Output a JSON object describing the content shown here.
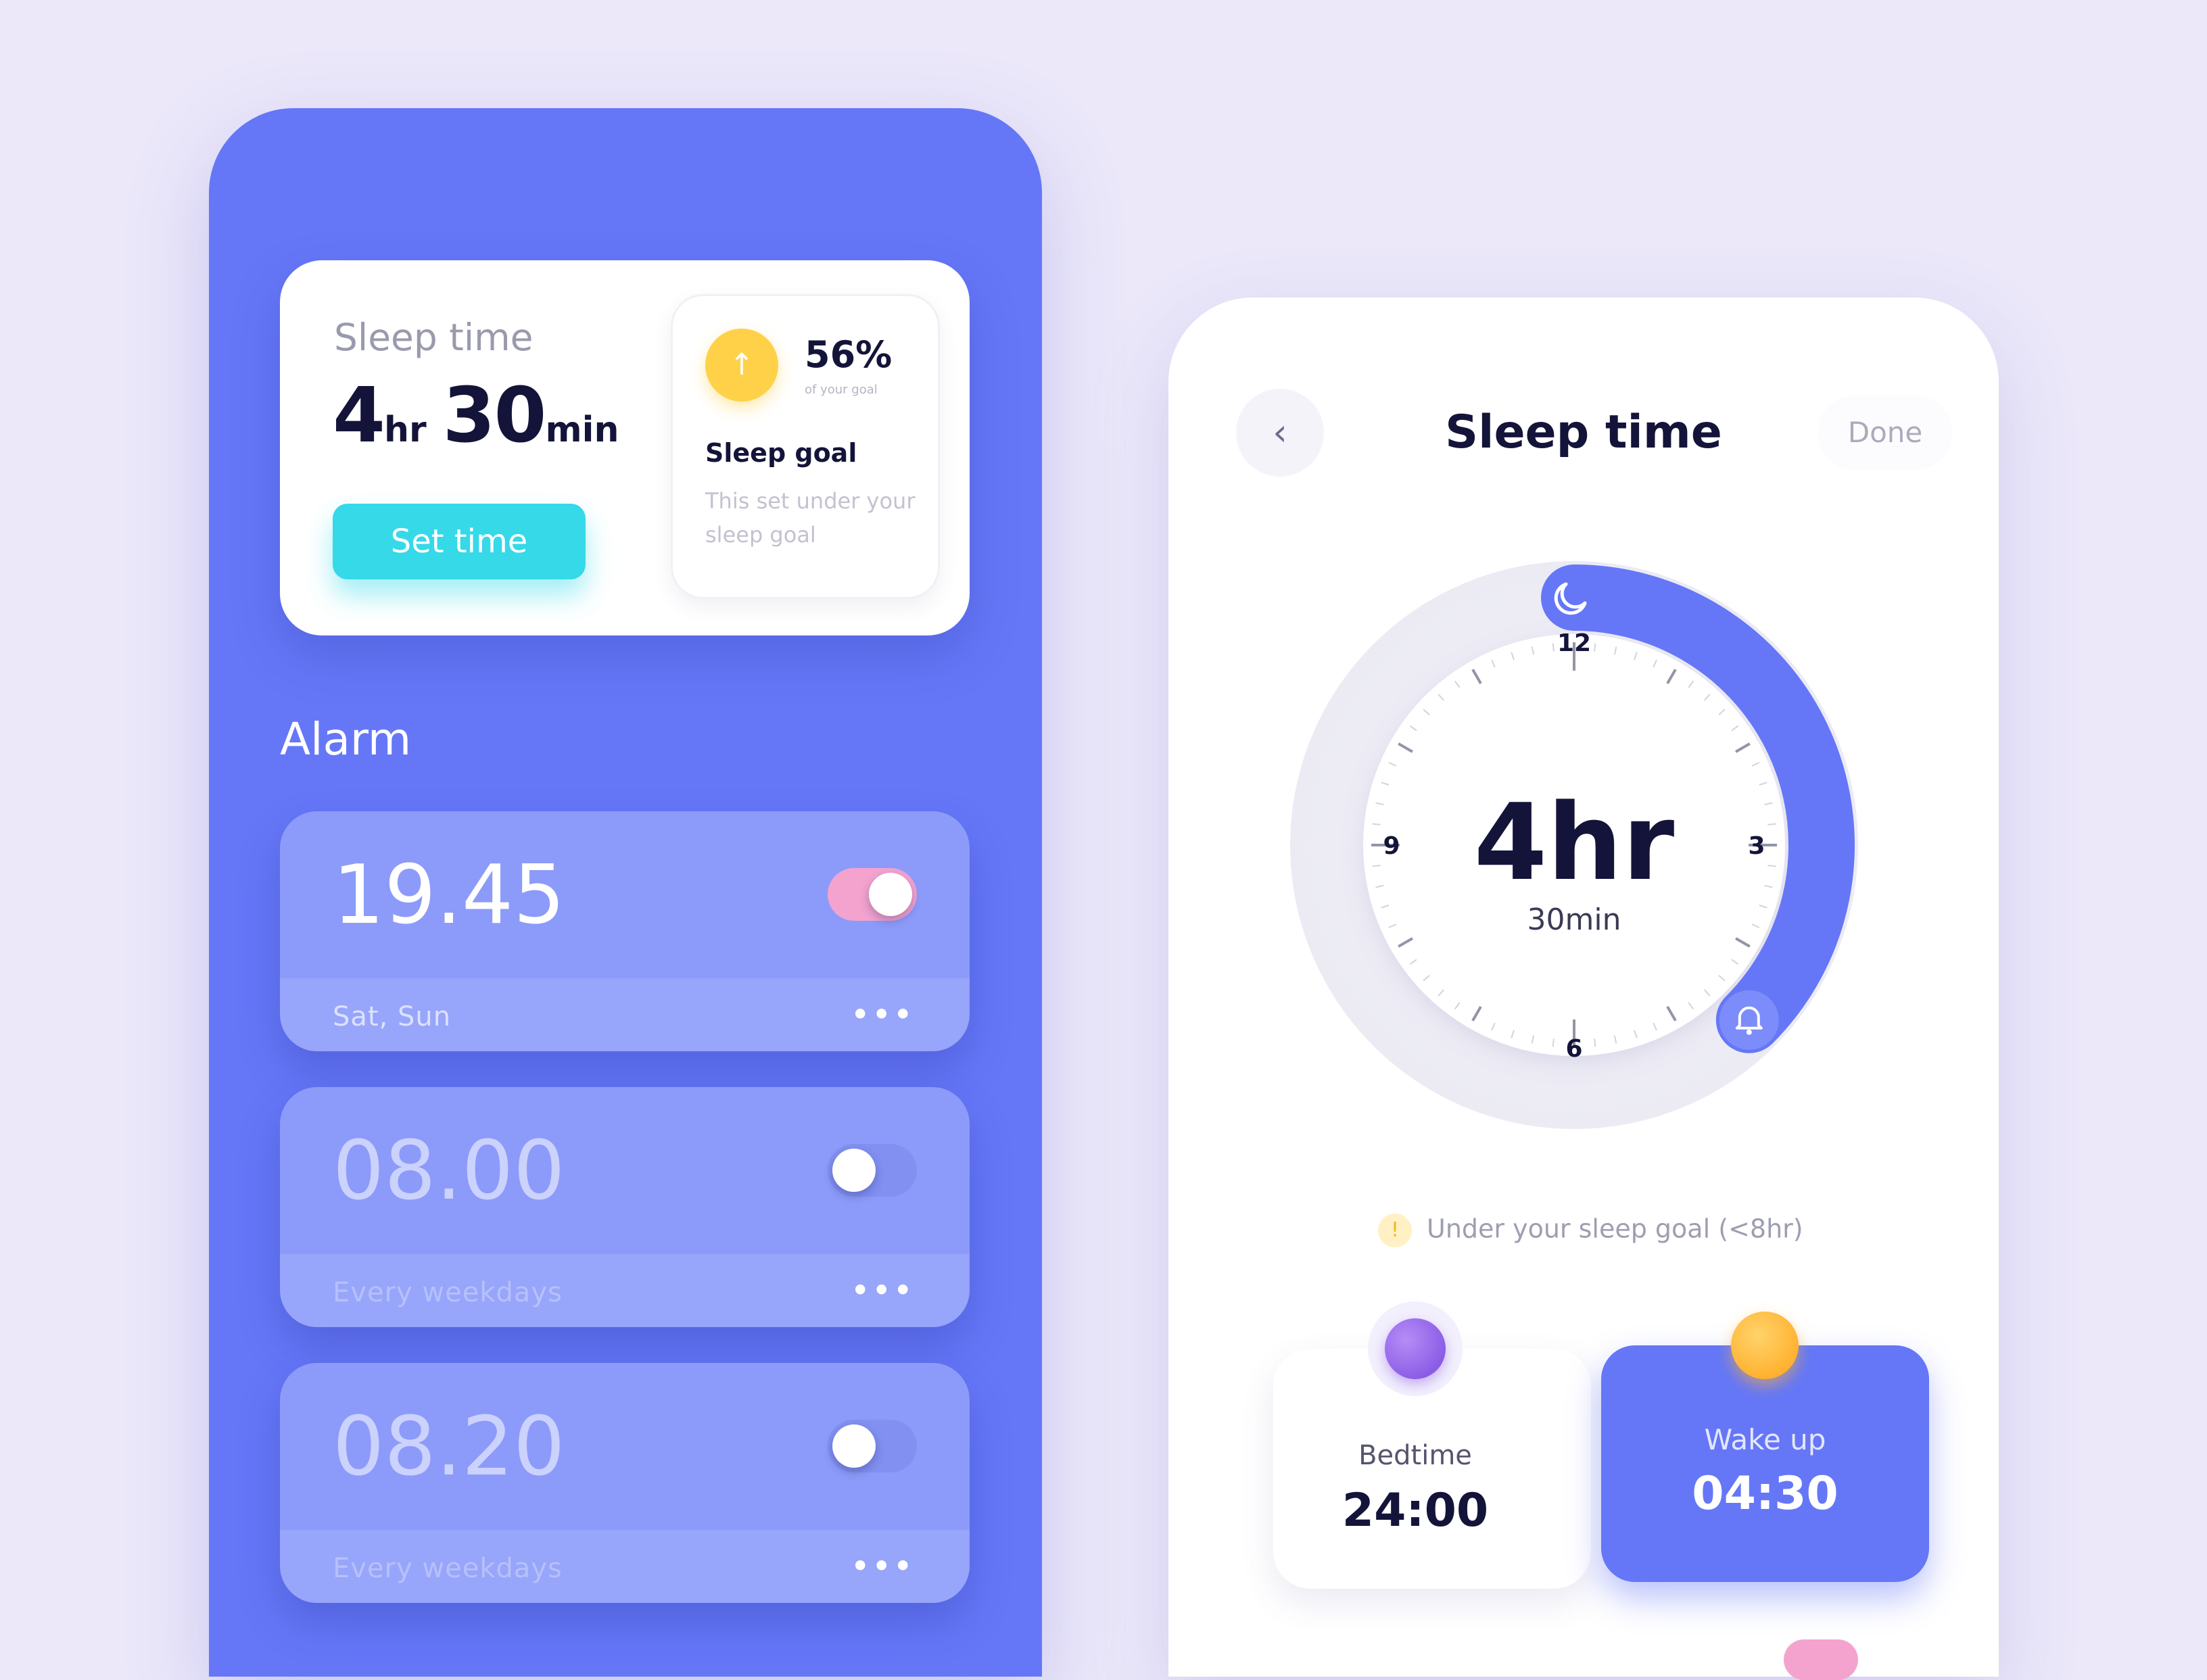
{
  "left_screen": {
    "sleep_card": {
      "title": "Sleep time",
      "hours": "4",
      "hours_unit": "hr",
      "minutes": "30",
      "minutes_unit": "min",
      "set_time_label": "Set time",
      "goal": {
        "icon": "arrow-up-icon",
        "percent": "56%",
        "percent_caption": "of your goal",
        "title": "Sleep goal",
        "description": "This set under your sleep goal"
      }
    },
    "alarm_heading": "Alarm",
    "alarms": [
      {
        "time": "19.45",
        "days": "Sat, Sun",
        "enabled": true,
        "more": "•••"
      },
      {
        "time": "08.00",
        "days": "Every weekdays",
        "enabled": false,
        "more": "•••"
      },
      {
        "time": "08.20",
        "days": "Every weekdays",
        "enabled": false,
        "more": "•••"
      }
    ]
  },
  "right_screen": {
    "back_icon": "chevron-left-icon",
    "back_glyph": "‹",
    "title": "Sleep time",
    "done_label": "Done",
    "dial": {
      "hours": "4hr",
      "minutes": "30min",
      "labels": {
        "top": "12",
        "right": "3",
        "bottom": "6",
        "left": "9"
      },
      "bedtime_icon": "moon-icon",
      "wake_icon": "bell-icon",
      "sleep_arc_start": "24:00",
      "sleep_arc_end": "04:30"
    },
    "goal_note": {
      "icon": "warning-icon",
      "glyph": "!",
      "text": "Under your sleep goal (<8hr)"
    },
    "bedtime": {
      "label": "Bedtime",
      "time": "24:00",
      "icon": "moon-planet-icon"
    },
    "wakeup": {
      "label": "Wake up",
      "time": "04:30",
      "icon": "sun-icon"
    }
  },
  "colors": {
    "background": "#ECE8FA",
    "primary": "#6577F7",
    "cyan_button": "#35D9E8",
    "toggle_on": "#F4A3CF",
    "goal_yellow": "#FFD149",
    "text_dark": "#14143A"
  }
}
